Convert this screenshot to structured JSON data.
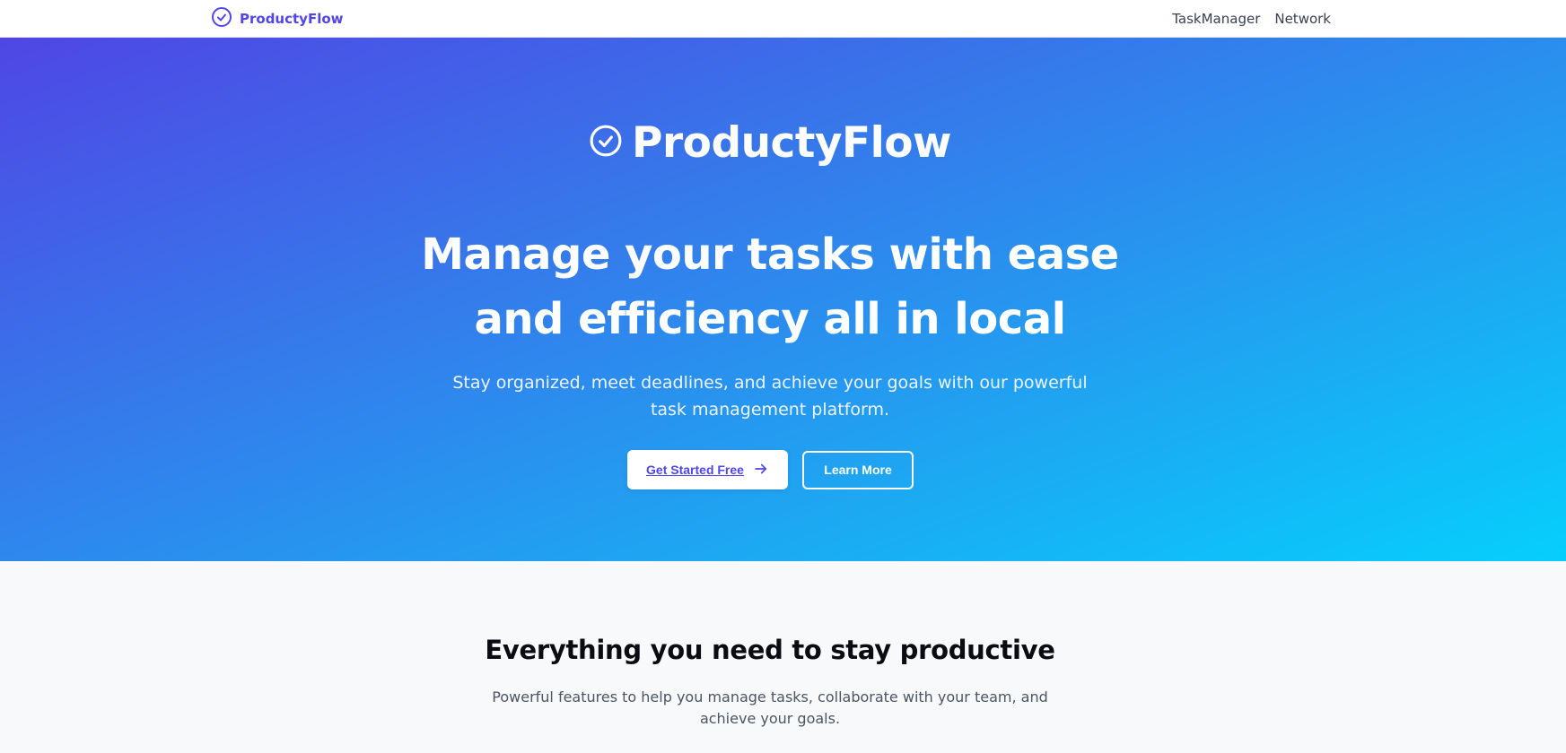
{
  "brand": {
    "name": "ProductyFlow",
    "icon": "check-circle-icon",
    "color": "#4f46e5"
  },
  "nav": {
    "links": [
      {
        "label": "TaskManager"
      },
      {
        "label": "Network"
      }
    ]
  },
  "hero": {
    "logo_text": "ProductyFlow",
    "logo_icon": "check-circle-icon",
    "headline": "Manage your tasks with ease and efficiency all in local",
    "subtitle": "Stay organized, meet deadlines, and achieve your goals with our powerful task management platform.",
    "primary_button": {
      "label": "Get Started Free",
      "icon": "arrow-right-icon"
    },
    "secondary_button": {
      "label": "Learn More"
    },
    "gradient": {
      "start": "#4f46e5",
      "end": "#06cffc"
    }
  },
  "features": {
    "title": "Everything you need to stay productive",
    "subtitle": "Powerful features to help you manage tasks, collaborate with your team, and achieve your goals."
  }
}
